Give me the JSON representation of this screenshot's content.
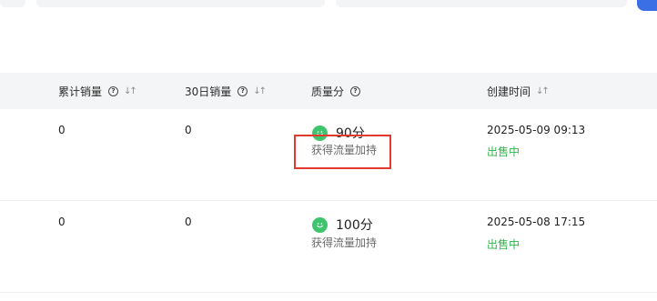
{
  "table": {
    "headers": {
      "cumulative_sales": "累计销量",
      "sales_30d": "30日销量",
      "quality_score": "质量分",
      "created_time": "创建时间"
    },
    "rows": [
      {
        "cumulative_sales": "0",
        "sales_30d": "0",
        "quality_score": "90分",
        "quality_note": "获得流量加持",
        "created_time": "2025-05-09 09:13",
        "status": "出售中"
      },
      {
        "cumulative_sales": "0",
        "sales_30d": "0",
        "quality_score": "100分",
        "quality_note": "获得流量加持",
        "created_time": "2025-05-08 17:15",
        "status": "出售中"
      }
    ]
  },
  "icons": {
    "help": "question-circle-icon",
    "sort": "sort-arrows-icon",
    "quality": "smiley-icon"
  },
  "colors": {
    "status_green": "#2fb64b",
    "quality_icon_green": "#3ec46d",
    "highlight_red": "#e23a2c",
    "header_bg": "#f4f5f7",
    "accent_blue": "#3a6fe6"
  }
}
